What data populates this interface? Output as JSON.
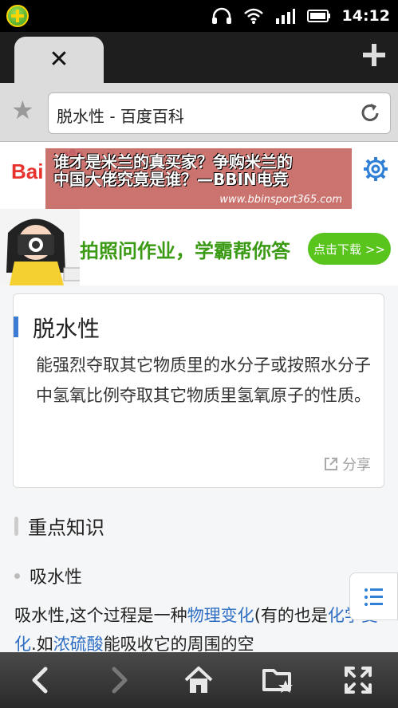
{
  "status_bar": {
    "time": "14:12"
  },
  "address_bar": {
    "url_title": "脱水性 - 百度百科"
  },
  "baidu": {
    "logo": "Bai"
  },
  "watermark": {
    "line1": "谁才是米兰的真买家？争购米兰的",
    "line2": "中国大佬究竟是谁？—BBIN电竞",
    "url": "www.bbinsport365.com"
  },
  "ad": {
    "headline": "拍照问作业，学霸帮你答",
    "download_label": "点击下载 >>"
  },
  "card": {
    "title": "脱水性",
    "description": "能强烈夺取其它物质里的水分子或按照水分子中氢氧比例夺取其它物质里氢氧原子的性质。",
    "share_label": "分享"
  },
  "section": {
    "heading": "重点知识"
  },
  "subsection": {
    "title": "吸水性"
  },
  "body": {
    "part1": "吸水性,这个过程是一种",
    "link1": "物理变化",
    "part2": "(有的也是",
    "link2": "化学变化",
    "part3": ".如",
    "link3": "浓硫酸",
    "part4": "能吸收它的周围的空"
  },
  "colors": {
    "accent_blue": "#3b7bd4",
    "link_blue": "#2e6fc4",
    "ad_green": "#58c41c",
    "baidu_red": "#e8322e"
  }
}
